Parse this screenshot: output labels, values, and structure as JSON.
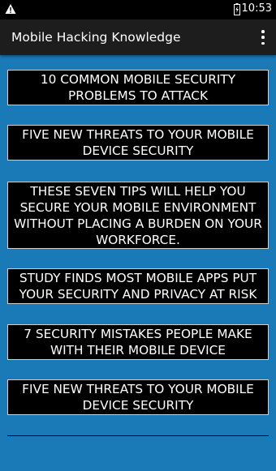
{
  "status_bar": {
    "time": "10:53",
    "icons": [
      "warning-icon",
      "battery-charging-icon"
    ]
  },
  "app_bar": {
    "title": "Mobile Hacking Knowledge",
    "menu_icon": "overflow-menu-icon"
  },
  "articles": [
    {
      "title": "10 COMMON MOBILE SECURITY PROBLEMS TO ATTACK"
    },
    {
      "title": "FIVE NEW THREATS TO YOUR MOBILE DEVICE SECURITY"
    },
    {
      "title": "THESE SEVEN TIPS WILL HELP YOU SECURE YOUR MOBILE ENVIRONMENT WITHOUT PLACING A BURDEN ON YOUR WORKFORCE."
    },
    {
      "title": "STUDY FINDS MOST MOBILE APPS PUT YOUR SECURITY AND PRIVACY AT RISK"
    },
    {
      "title": "7 SECURITY MISTAKES PEOPLE MAKE WITH THEIR MOBILE DEVICE"
    },
    {
      "title": "FIVE NEW THREATS TO YOUR MOBILE DEVICE SECURITY"
    }
  ],
  "colors": {
    "background": "#1a7ab8",
    "app_bar": "#1d1d1d",
    "item_background": "#000000",
    "item_text": "#ffffff"
  }
}
